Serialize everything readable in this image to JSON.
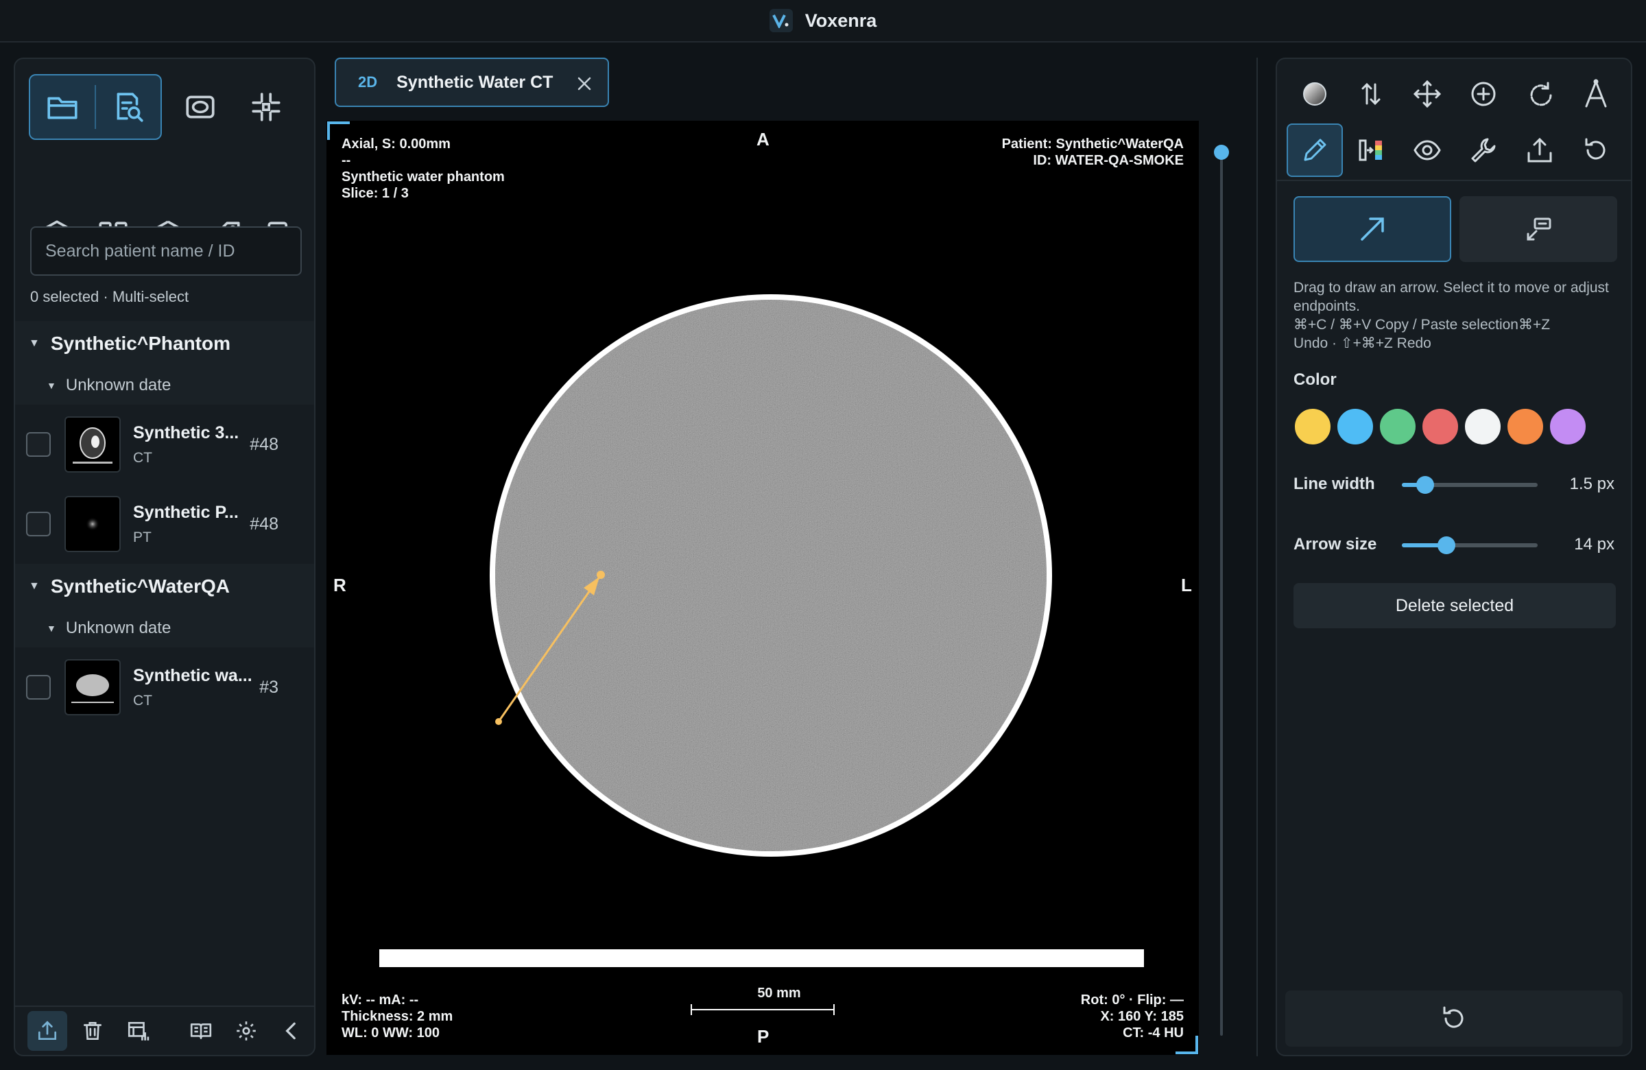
{
  "app": {
    "title": "Voxenra"
  },
  "left": {
    "search": {
      "placeholder": "Search patient name / ID",
      "value": ""
    },
    "selection_info": "0 selected · Multi-select",
    "patients": [
      {
        "name": "Synthetic^Phantom",
        "date": "Unknown date",
        "series": [
          {
            "name": "Synthetic 3...",
            "modality": "CT",
            "count": "#48"
          },
          {
            "name": "Synthetic P...",
            "modality": "PT",
            "count": "#48"
          }
        ]
      },
      {
        "name": "Synthetic^WaterQA",
        "date": "Unknown date",
        "series": [
          {
            "name": "Synthetic wa...",
            "modality": "CT",
            "count": "#3"
          }
        ]
      }
    ]
  },
  "tab": {
    "mode": "2D",
    "title": "Synthetic Water CT"
  },
  "viewport": {
    "top_left": {
      "line1": "Axial, S: 0.00mm",
      "line2": "--",
      "line3": "Synthetic water phantom",
      "line4": "Slice: 1 / 3"
    },
    "top_right": {
      "line1": "Patient: Synthetic^WaterQA",
      "line2": "ID: WATER-QA-SMOKE"
    },
    "bottom_left": {
      "line1": "kV: --   mA: --",
      "line2": "Thickness: 2 mm",
      "line3": "WL: 0   WW: 100"
    },
    "bottom_right": {
      "line1": "Rot: 0° · Flip: —",
      "line2": "X: 160   Y: 185",
      "line3": "CT: -4 HU"
    },
    "scale_label": "50 mm",
    "orientation": {
      "top": "A",
      "bottom": "P",
      "left": "R",
      "right": "L"
    },
    "annotation_color": "#f7c060"
  },
  "right": {
    "help": {
      "line1": "Drag to draw an arrow. Select it to move or adjust endpoints.",
      "line2": "⌘+C / ⌘+V Copy / Paste selection⌘+Z",
      "line3": "Undo · ⇧+⌘+Z Redo"
    },
    "color_label": "Color",
    "colors": [
      "#f8cf4f",
      "#4fbcf5",
      "#5fc98a",
      "#e86a6a",
      "#f2f4f5",
      "#f58a45",
      "#c38cf3"
    ],
    "line_width": {
      "label": "Line width",
      "value": "1.5 px",
      "fraction": 0.17
    },
    "arrow_size": {
      "label": "Arrow size",
      "value": "14 px",
      "fraction": 0.33
    },
    "delete_label": "Delete selected"
  }
}
